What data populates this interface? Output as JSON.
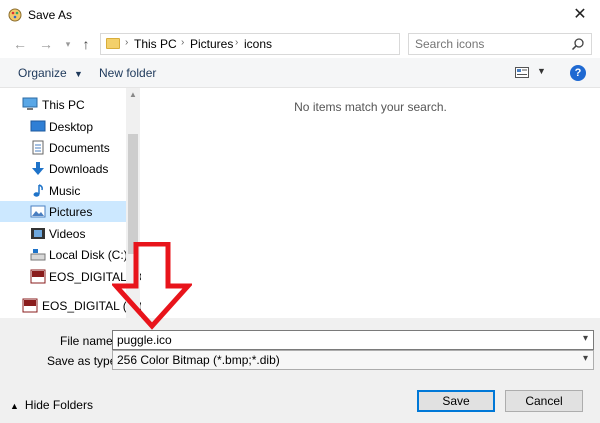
{
  "window": {
    "title": "Save As"
  },
  "address": {
    "crumbs": [
      "This PC",
      "Pictures",
      "icons"
    ]
  },
  "search": {
    "placeholder": "Search icons"
  },
  "toolbar": {
    "organize_label": "Organize",
    "new_folder_label": "New folder"
  },
  "nav": {
    "items": [
      {
        "label": "This PC",
        "icon": "computer-icon"
      },
      {
        "label": "Desktop",
        "icon": "desktop-icon"
      },
      {
        "label": "Documents",
        "icon": "documents-icon"
      },
      {
        "label": "Downloads",
        "icon": "downloads-icon"
      },
      {
        "label": "Music",
        "icon": "music-icon"
      },
      {
        "label": "Pictures",
        "icon": "pictures-icon"
      },
      {
        "label": "Videos",
        "icon": "videos-icon"
      },
      {
        "label": "Local Disk (C:)",
        "icon": "drive-icon"
      },
      {
        "label": "EOS_DIGITAL (D:",
        "icon": "sd-card-icon"
      }
    ],
    "selected": "Pictures",
    "bottom_item": {
      "label": "EOS_DIGITAL (D:)",
      "icon": "sd-card-icon"
    }
  },
  "content": {
    "empty_message": "No items match your search."
  },
  "form": {
    "filename_label": "File name:",
    "filename_value": "puggle.ico",
    "type_label": "Save as type:",
    "type_value": "256 Color Bitmap (*.bmp;*.dib)"
  },
  "footer": {
    "hide_folders_label": "Hide Folders",
    "save_label": "Save",
    "cancel_label": "Cancel"
  },
  "colors": {
    "accent": "#0078d7",
    "selection": "#cce8ff",
    "annotation_arrow": "#e8141b"
  }
}
